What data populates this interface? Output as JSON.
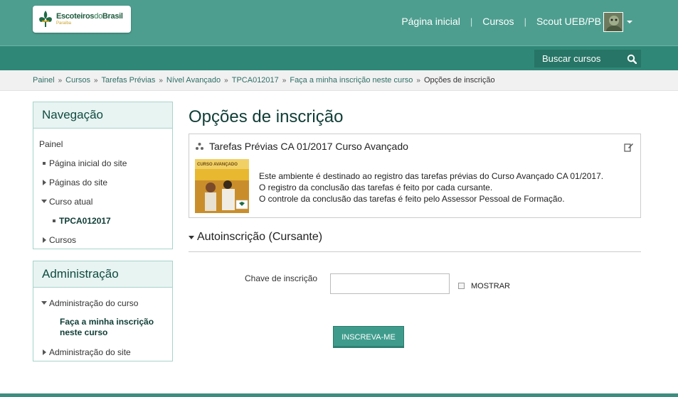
{
  "header": {
    "logo": {
      "brand_a": "Escoteiros",
      "brand_b": "do",
      "brand_c": "Brasil",
      "region": "Paraíba"
    },
    "nav": {
      "home": "Página inicial",
      "courses": "Cursos",
      "user": "Scout UEB/PB"
    },
    "search_label": "Buscar cursos"
  },
  "breadcrumb": {
    "items": [
      "Painel",
      "Cursos",
      "Tarefas Prévias",
      "Nível Avançado",
      "TPCA012017",
      "Faça a minha inscrição neste curso"
    ],
    "current": "Opções de inscrição",
    "separator": "»"
  },
  "navigation": {
    "title": "Navegação",
    "root": "Painel",
    "items": [
      {
        "label": "Página inicial do site",
        "indicator": "bullet"
      },
      {
        "label": "Páginas do site",
        "indicator": "collapsed"
      },
      {
        "label": "Curso atual",
        "indicator": "expanded"
      },
      {
        "label": "TPCA012017",
        "indicator": "bullet"
      },
      {
        "label": "Cursos",
        "indicator": "collapsed"
      }
    ]
  },
  "administration": {
    "title": "Administração",
    "items": [
      {
        "label": "Administração do curso",
        "indicator": "expanded"
      },
      {
        "label": "Faça a minha inscrição neste curso",
        "indicator": "none"
      },
      {
        "label": "Administração do site",
        "indicator": "collapsed"
      }
    ]
  },
  "main": {
    "title": "Opções de inscrição",
    "course": {
      "name": "Tarefas Prévias CA 01/2017 Curso Avançado",
      "thumb_title": "CURSO AVANÇADO",
      "summary": [
        "Este ambiente é destinado ao registro das tarefas prévias do Curso Avançado CA 01/2017.",
        "O registro da conclusão das tarefas é feito por cada cursante.",
        "O controle da conclusão das tarefas é feito pelo Assessor Pessoal de Formação."
      ]
    },
    "section_title": "Autoinscrição (Cursante)",
    "form": {
      "key_label": "Chave de inscrição",
      "key_value": "",
      "show_label": "MOSTRAR",
      "submit_label": "INSCREVA-ME"
    }
  },
  "colors": {
    "header": "#4d9e8f",
    "subbar": "#2f8777",
    "block_border": "#a8d3ca",
    "block_head": "#e8f4f2",
    "button": "#3f9c8d"
  }
}
